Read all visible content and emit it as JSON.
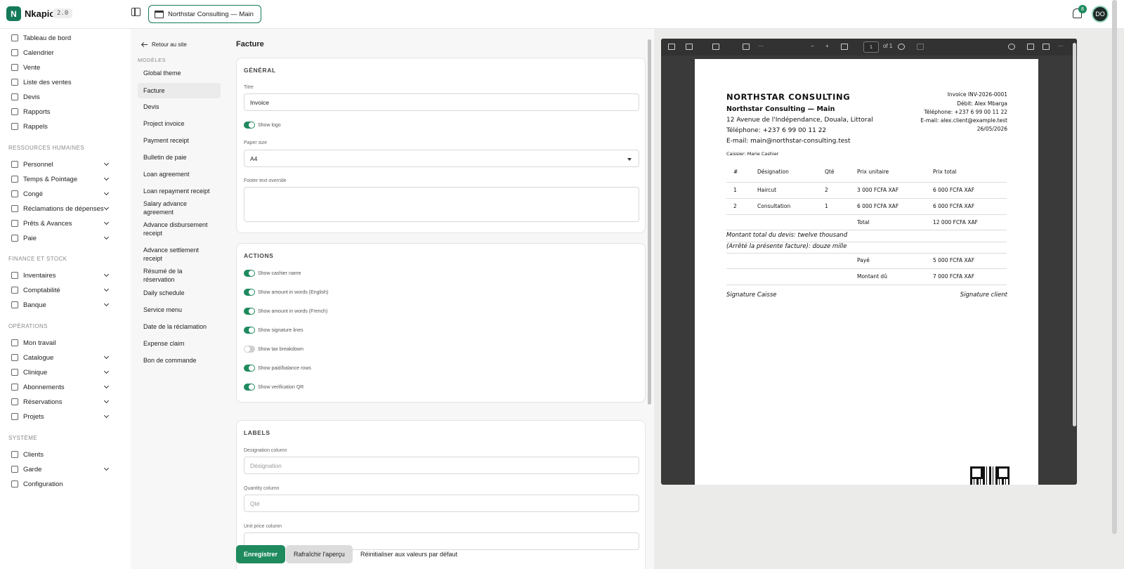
{
  "app": {
    "logo_letter": "N",
    "name": "Nkapio",
    "version": "2.0",
    "store": "Northstar Consulting — Main",
    "notifications": "8",
    "avatar": "DO"
  },
  "nav": {
    "main": [
      {
        "label": "Tableau de bord",
        "icon": "dashboard-icon"
      },
      {
        "label": "Calendrier",
        "icon": "calendar-icon"
      },
      {
        "label": "Vente",
        "icon": "grid-icon"
      },
      {
        "label": "Liste des ventes",
        "icon": "cart-icon"
      },
      {
        "label": "Devis",
        "icon": "document-icon"
      },
      {
        "label": "Rapports",
        "icon": "chart-icon"
      },
      {
        "label": "Rappels",
        "icon": "calendar-alert-icon"
      }
    ],
    "hr_section": "RESSOURCES HUMAINES",
    "hr": [
      {
        "label": "Personnel",
        "icon": "users-icon"
      },
      {
        "label": "Temps & Pointage",
        "icon": "clock-icon"
      },
      {
        "label": "Congé",
        "icon": "briefcase-icon"
      },
      {
        "label": "Réclamations de dépenses",
        "icon": "receipt-icon"
      },
      {
        "label": "Prêts & Avances",
        "icon": "loan-icon"
      },
      {
        "label": "Paie",
        "icon": "wallet-icon"
      }
    ],
    "finance_section": "FINANCE ET STOCK",
    "finance": [
      {
        "label": "Inventaires",
        "icon": "box-icon"
      },
      {
        "label": "Comptabilité",
        "icon": "book-icon"
      },
      {
        "label": "Banque",
        "icon": "bank-icon"
      }
    ],
    "ops_section": "OPÉRATIONS",
    "ops": [
      {
        "label": "Mon travail",
        "icon": "wrench-icon",
        "chevron": false
      },
      {
        "label": "Catalogue",
        "icon": "tag-icon",
        "chevron": true
      },
      {
        "label": "Clinique",
        "icon": "stethoscope-icon",
        "chevron": true
      },
      {
        "label": "Abonnements",
        "icon": "repeat-icon",
        "chevron": true
      },
      {
        "label": "Réservations",
        "icon": "calendar-icon",
        "chevron": true
      },
      {
        "label": "Projets",
        "icon": "folder-icon",
        "chevron": true
      }
    ],
    "system_section": "SYSTÈME",
    "system": [
      {
        "label": "Clients",
        "icon": "user-icon",
        "chevron": false
      },
      {
        "label": "Garde",
        "icon": "shield-icon",
        "chevron": true
      },
      {
        "label": "Configuration",
        "icon": "gear-icon",
        "chevron": false
      }
    ]
  },
  "templates": {
    "back": "Retour au site",
    "section": "MODÈLES",
    "items": [
      "Global theme",
      "Facture",
      "Devis",
      "Project invoice",
      "Payment receipt",
      "Bulletin de paie",
      "Loan agreement",
      "Loan repayment receipt",
      "Salary advance agreement",
      "Advance disbursement receipt",
      "Advance settlement receipt",
      "Résumé de la réservation",
      "Daily schedule",
      "Service menu",
      "Date de la réclamation",
      "Expense claim",
      "Bon de commande"
    ]
  },
  "form": {
    "title": "Facture",
    "general": {
      "title": "GÉNÉRAL",
      "titre_label": "Titre",
      "titre_value": "Invoice",
      "show_logo": "Show logo",
      "paper_label": "Paper size",
      "paper_value": "A4",
      "footer_label": "Footer text override"
    },
    "actions": {
      "title": "ACTIONS",
      "toggles": [
        {
          "label": "Show cashier name",
          "on": true
        },
        {
          "label": "Show amount in words (English)",
          "on": true
        },
        {
          "label": "Show amount in words (French)",
          "on": true
        },
        {
          "label": "Show signature lines",
          "on": true
        },
        {
          "label": "Show tax breakdown",
          "on": false
        },
        {
          "label": "Show paid/balance rows",
          "on": true
        },
        {
          "label": "Show verification QR",
          "on": true
        }
      ]
    },
    "labels": {
      "title": "LABELS",
      "designation_label": "Designation column",
      "designation_placeholder": "Désignation",
      "quantity_label": "Quantity column",
      "quantity_placeholder": "Qté",
      "unit_price_label": "Unit price column"
    },
    "buttons": {
      "save": "Enregistrer",
      "refresh": "Rafraîchir l'aperçu",
      "reset": "Réinitialiser aux valeurs par défaut"
    }
  },
  "pdf": {
    "page_number": "1",
    "page_count": "of 1",
    "company": "NORTHSTAR CONSULTING",
    "branch": "Northstar Consulting — Main",
    "address": "12 Avenue de l'Indépendance, Douala, Littoral",
    "phone": "Téléphone: +237 6 99 00 11 22",
    "email": "E-mail: main@northstar-consulting.test",
    "invoice_no": "Invoice INV-2026-0001",
    "debit": "Débit: Alex Mbarga",
    "client_phone": "Téléphone: +237 6 99 00 11 22",
    "client_email": "E-mail: alex.client@example.test",
    "date": "26/05/2026",
    "cashier": "Caissier: Marie Cashier",
    "headers": [
      "#",
      "Désignation",
      "Qté",
      "Prix unitaire",
      "Prix total"
    ],
    "rows": [
      [
        "1",
        "Haircut",
        "2",
        "3 000 FCFA XAF",
        "6 000 FCFA XAF"
      ],
      [
        "2",
        "Consultation",
        "1",
        "6 000 FCFA XAF",
        "6 000 FCFA XAF"
      ]
    ],
    "total_label": "Total",
    "total_value": "12 000 FCFA XAF",
    "words_en": "Montant total du devis: twelve thousand",
    "words_fr": "(Arrêté la présente facture): douze mille",
    "paid_label": "Payé",
    "paid_value": "5 000 FCFA XAF",
    "due_label": "Montant dû",
    "due_value": "7 000 FCFA XAF",
    "sign_cashier": "Signature Caisse",
    "sign_client": "Signature client"
  }
}
